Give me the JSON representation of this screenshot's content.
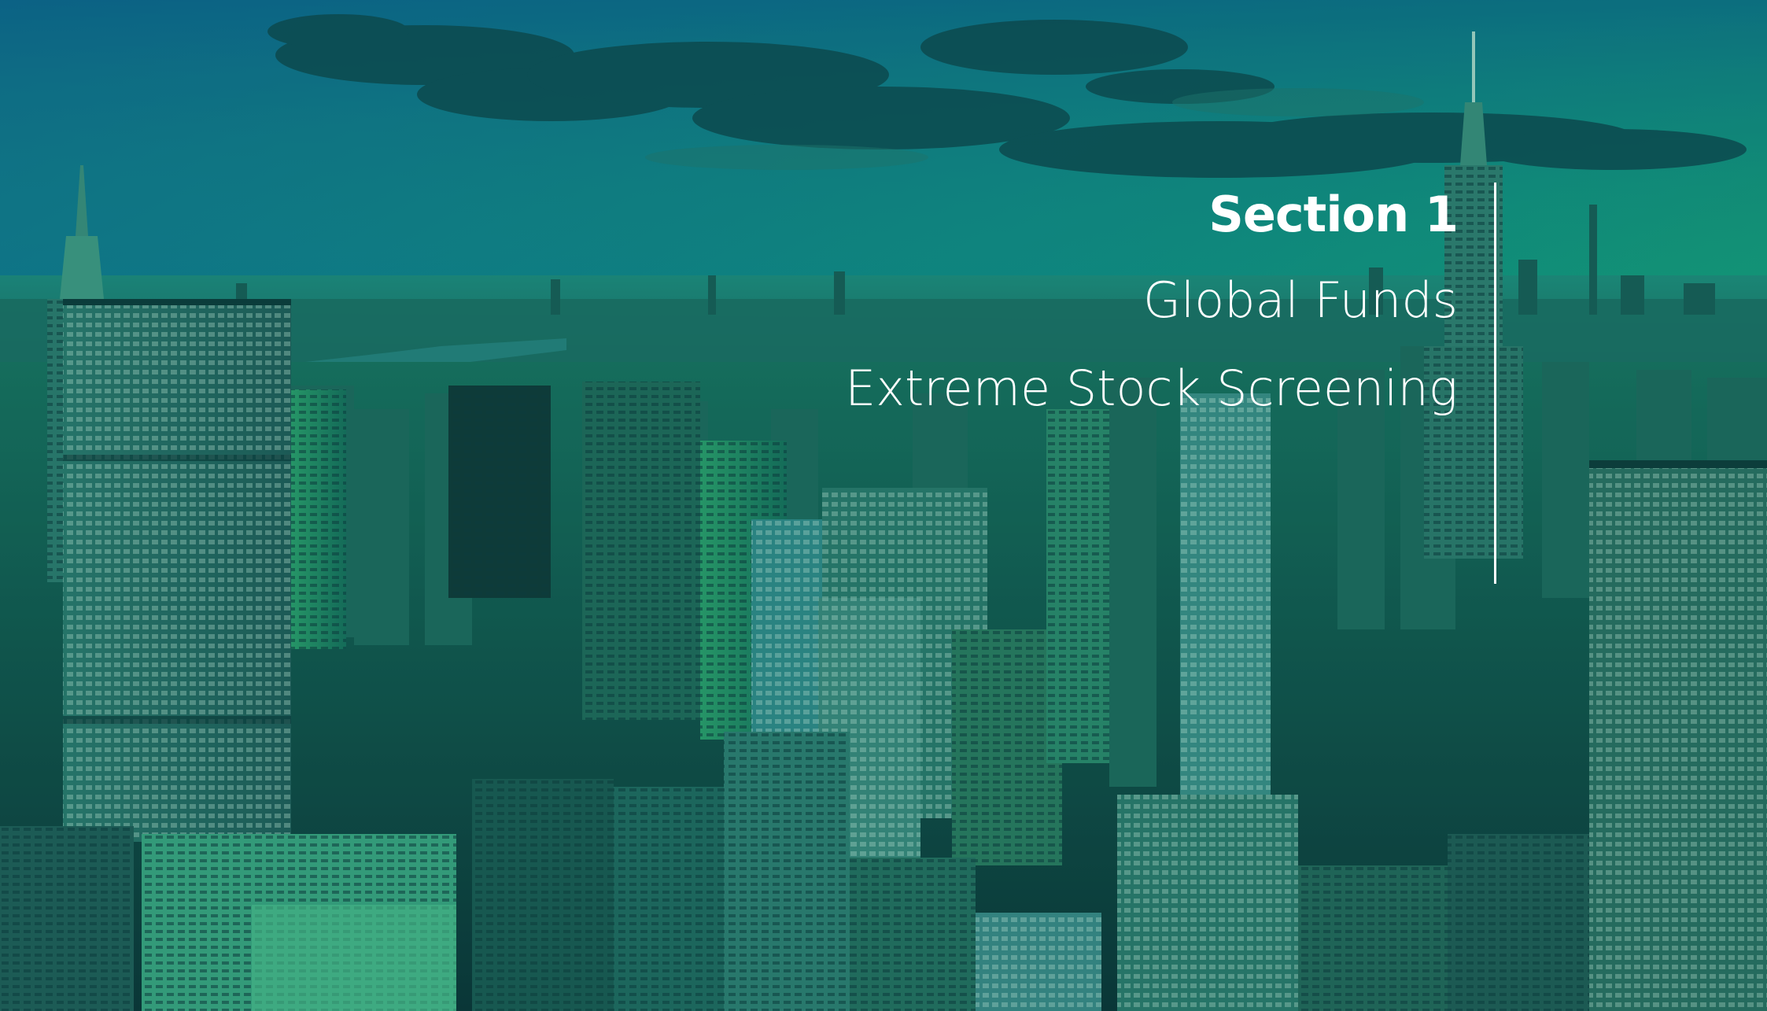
{
  "slide": {
    "section_label": "Section 1",
    "subtitles": [
      "Global Funds",
      "Extreme Stock Screening"
    ]
  },
  "background": {
    "description_tag": "city-skyline-photo",
    "tint_colors": [
      "#0e6f8a",
      "#16b06c",
      "#0a3b3c"
    ]
  },
  "colors": {
    "text": "#ffffff",
    "divider": "#ffffff"
  }
}
